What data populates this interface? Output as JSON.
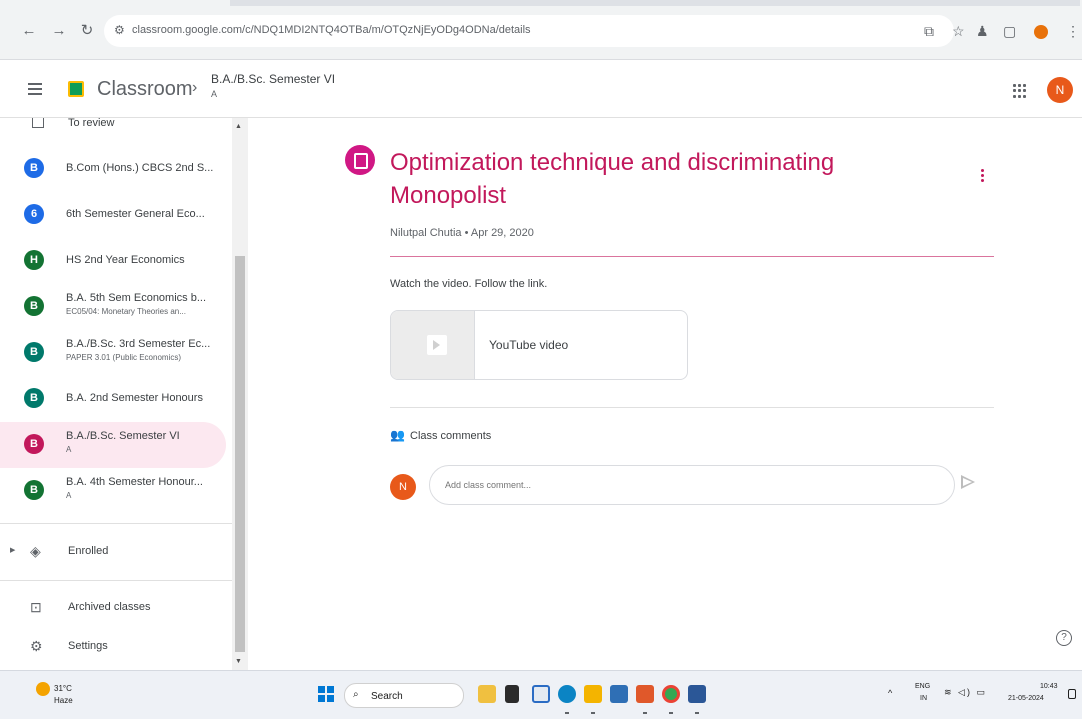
{
  "browser": {
    "url": "classroom.google.com/c/NDQ1MDI2NTQ4OTBa/m/OTQzNjEyODg4ODNa/details"
  },
  "header": {
    "app_name": "Classroom",
    "breadcrumb_title": "B.A./B.Sc. Semester VI",
    "breadcrumb_sub": "A",
    "avatar_letter": "N"
  },
  "sidebar": {
    "review_label": "To review",
    "classes": [
      {
        "letter": "B",
        "color": "#1e6be6",
        "name": "B.Com (Hons.) CBCS 2nd S...",
        "sub": ""
      },
      {
        "letter": "6",
        "color": "#1e6be6",
        "name": "6th Semester General Eco...",
        "sub": ""
      },
      {
        "letter": "H",
        "color": "#137333",
        "name": "HS 2nd Year Economics",
        "sub": ""
      },
      {
        "letter": "B",
        "color": "#137333",
        "name": "B.A. 5th Sem Economics b...",
        "sub": "EC05/04: Monetary Theories an..."
      },
      {
        "letter": "B",
        "color": "#00796b",
        "name": "B.A./B.Sc. 3rd Semester Ec...",
        "sub": "PAPER 3.01 (Public Economics)"
      },
      {
        "letter": "B",
        "color": "#00796b",
        "name": "B.A. 2nd Semester Honours",
        "sub": ""
      },
      {
        "letter": "B",
        "color": "#c2185b",
        "name": "B.A./B.Sc. Semester VI",
        "sub": "A"
      },
      {
        "letter": "B",
        "color": "#137333",
        "name": "B.A. 4th Semester Honour...",
        "sub": "A"
      }
    ],
    "enrolled_label": "Enrolled",
    "archived_label": "Archived classes",
    "settings_label": "Settings"
  },
  "post": {
    "title": "Optimization technique and discriminating Monopolist",
    "meta": "Nilutpal Chutia • Apr 29, 2020",
    "body": "Watch the video. Follow the link.",
    "attachment_label": "YouTube video",
    "comments_label": "Class comments",
    "comment_placeholder": "Add class comment...",
    "commenter_letter": "N"
  },
  "taskbar": {
    "weather_temp": "31°C",
    "weather_desc": "Haze",
    "search_label": "Search",
    "lang_1": "ENG",
    "lang_2": "IN",
    "time": "10:43",
    "date": "21-05-2024"
  },
  "colors": {
    "accent": "#c2185b",
    "active_bg": "#fce8f0"
  }
}
